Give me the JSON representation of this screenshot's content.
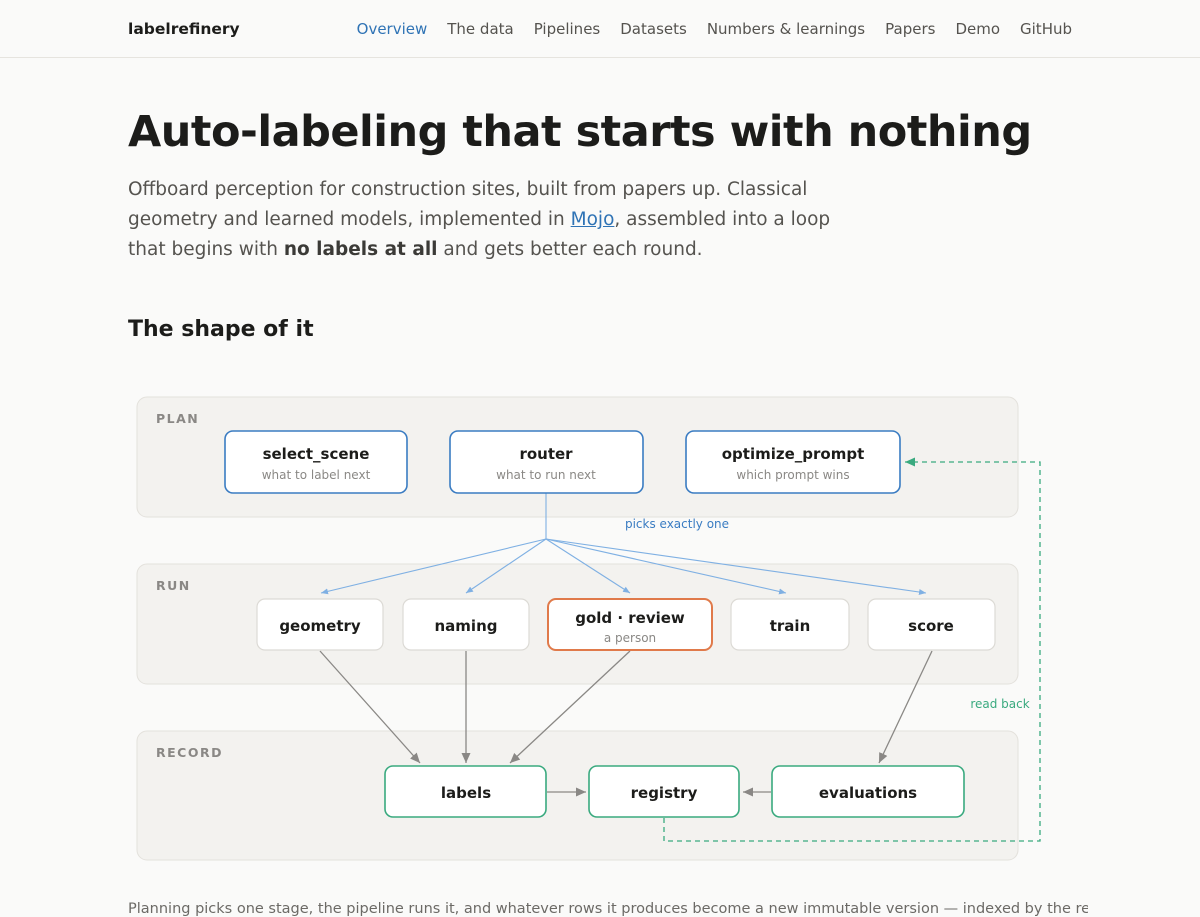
{
  "header": {
    "brand": "labelrefinery",
    "nav": [
      "Overview",
      "The data",
      "Pipelines",
      "Datasets",
      "Numbers & learnings",
      "Papers",
      "Demo",
      "GitHub"
    ],
    "active_nav": "Overview"
  },
  "hero": {
    "title": "Auto-labeling that starts with nothing",
    "lead_part1": "Offboard perception for construction sites, built from papers up. Classical geometry and learned models, implemented in ",
    "lead_link": "Mojo",
    "lead_part2": ", assembled into a loop that begins with ",
    "lead_bold": "no labels at all",
    "lead_part3": " and gets better each round."
  },
  "section": {
    "title": "The shape of it"
  },
  "diagram": {
    "lanes": {
      "plan": "PLAN",
      "run": "RUN",
      "record": "RECORD"
    },
    "plan_nodes": [
      {
        "title": "select_scene",
        "subtitle": "what to label next"
      },
      {
        "title": "router",
        "subtitle": "what to run next"
      },
      {
        "title": "optimize_prompt",
        "subtitle": "which prompt wins"
      }
    ],
    "run_nodes": [
      {
        "title": "geometry"
      },
      {
        "title": "naming"
      },
      {
        "title": "gold · review",
        "subtitle": "a person"
      },
      {
        "title": "train"
      },
      {
        "title": "score"
      }
    ],
    "record_nodes": [
      {
        "title": "labels"
      },
      {
        "title": "registry"
      },
      {
        "title": "evaluations"
      }
    ],
    "edge_labels": {
      "picks": "picks exactly one",
      "read_back": "read back"
    },
    "colors": {
      "plan": "#3a7cc2",
      "gold": "#e07a4a",
      "record": "#3aaa7f",
      "edge_blue": "#7fb0e3",
      "edge_gray": "#8a8885",
      "feedback": "#3aaa7f"
    }
  },
  "footnote": "Planning picks one stage, the pipeline runs it, and whatever rows it produces become a new immutable version — indexed by the registry that"
}
